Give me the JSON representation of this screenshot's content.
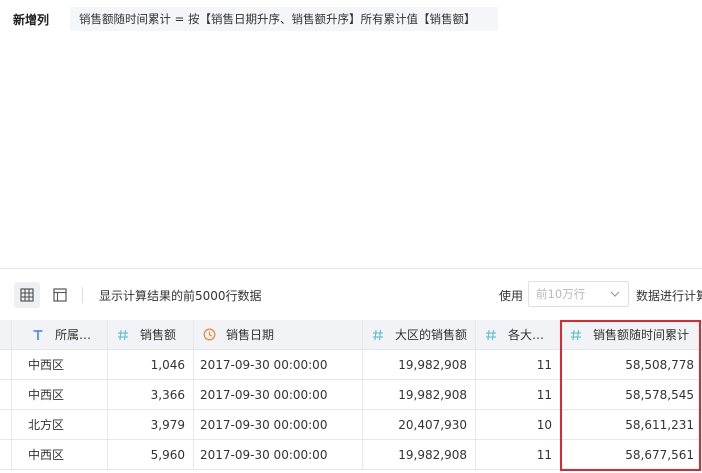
{
  "formula": {
    "label": "新增列",
    "text": "销售额随时间累计 = 按【销售日期升序、销售额升序】所有累计值【销售额】"
  },
  "toolbar": {
    "preview_text": "显示计算结果的前5000行数据",
    "use_label": "使用",
    "select_value": "前10万行",
    "after_select": "数据进行计算"
  },
  "table": {
    "columns": [
      {
        "label": "所属…",
        "icon": "text-type-icon"
      },
      {
        "label": "销售额",
        "icon": "number-type-icon"
      },
      {
        "label": "销售日期",
        "icon": "clock-icon"
      },
      {
        "label": "大区的销售额",
        "icon": "number-type-icon"
      },
      {
        "label": "各大…",
        "icon": "number-type-icon"
      },
      {
        "label": "销售额随时间累计",
        "icon": "number-type-icon"
      }
    ],
    "rows": [
      [
        "中西区",
        "1,046",
        "2017-09-30 00:00:00",
        "19,982,908",
        "11",
        "58,508,778"
      ],
      [
        "中西区",
        "3,366",
        "2017-09-30 00:00:00",
        "19,982,908",
        "11",
        "58,578,545"
      ],
      [
        "北方区",
        "3,979",
        "2017-09-30 00:00:00",
        "20,407,930",
        "10",
        "58,611,231"
      ],
      [
        "中西区",
        "5,960",
        "2017-09-30 00:00:00",
        "19,982,908",
        "11",
        "58,677,561"
      ]
    ]
  },
  "colors": {
    "accent_number": "#5fc7c3",
    "accent_text": "#3d7be0",
    "accent_date": "#f08a3c",
    "highlight": "#e0272e"
  }
}
